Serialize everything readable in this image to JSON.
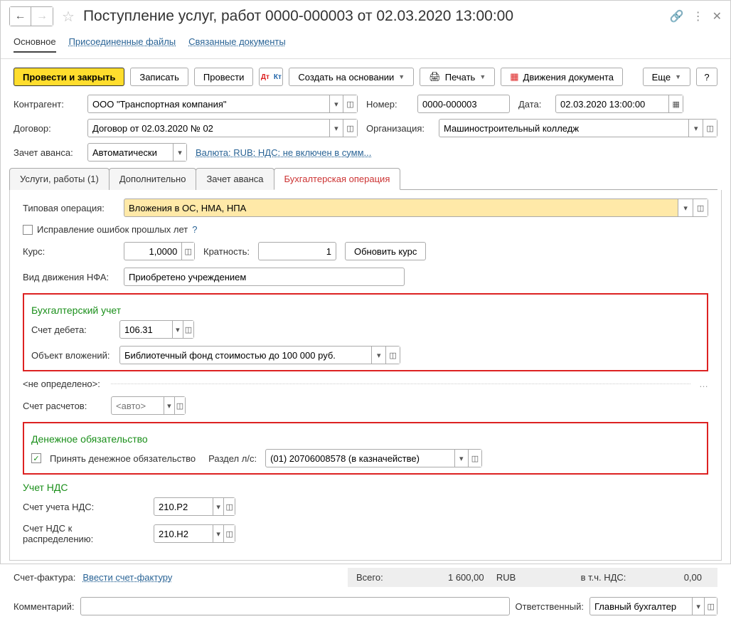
{
  "header": {
    "title": "Поступление услуг, работ 0000-000003 от 02.03.2020 13:00:00"
  },
  "nav": {
    "main": "Основное",
    "files": "Присоединенные файлы",
    "related": "Связанные документы"
  },
  "toolbar": {
    "post_close": "Провести и закрыть",
    "save": "Записать",
    "post": "Провести",
    "create_based": "Создать на основании",
    "print": "Печать",
    "movements": "Движения документа",
    "more": "Еще",
    "help": "?"
  },
  "fields": {
    "counterparty_lbl": "Контрагент:",
    "counterparty": "ООО \"Транспортная компания\"",
    "number_lbl": "Номер:",
    "number": "0000-000003",
    "date_lbl": "Дата:",
    "date": "02.03.2020 13:00:00",
    "contract_lbl": "Договор:",
    "contract": "Договор от 02.03.2020 № 02",
    "org_lbl": "Организация:",
    "org": "Машиностроительный колледж",
    "advance_lbl": "Зачет аванса:",
    "advance": "Автоматически",
    "currency_link": "Валюта: RUB; НДС: не включен в сумм..."
  },
  "inner_tabs": {
    "t1": "Услуги, работы (1)",
    "t2": "Дополнительно",
    "t3": "Зачет аванса",
    "t4": "Бухгалтерская операция"
  },
  "content": {
    "op_lbl": "Типовая операция:",
    "op": "Вложения в ОС, НМА, НПА",
    "fix_errors": "Исправление ошибок прошлых лет",
    "rate_lbl": "Курс:",
    "rate": "1,0000",
    "mult_lbl": "Кратность:",
    "mult": "1",
    "update_rate": "Обновить курс",
    "nfa_lbl": "Вид движения НФА:",
    "nfa": "Приобретено учреждением",
    "acc_title": "Бухгалтерский учет",
    "debit_lbl": "Счет дебета:",
    "debit": "106.31",
    "invest_lbl": "Объект вложений:",
    "invest": "Библиотечный фонд стоимостью до 100 000 руб.",
    "undef": "<не определено>:",
    "settle_lbl": "Счет расчетов:",
    "settle_ph": "<авто>",
    "money_title": "Денежное обязательство",
    "accept_money": "Принять денежное обязательство",
    "section_lbl": "Раздел л/с:",
    "section": "(01) 20706008578 (в казначействе)",
    "vat_title": "Учет НДС",
    "vat_acc_lbl": "Счет учета НДС:",
    "vat_acc": "210.Р2",
    "vat_dist_lbl": "Счет НДС к распределению:",
    "vat_dist": "210.Н2"
  },
  "footer": {
    "invoice_lbl": "Счет-фактура:",
    "invoice_link": "Ввести счет-фактуру",
    "total_lbl": "Всего:",
    "total": "1 600,00",
    "currency": "RUB",
    "vat_incl_lbl": "в т.ч. НДС:",
    "vat_incl": "0,00",
    "comment_lbl": "Комментарий:",
    "resp_lbl": "Ответственный:",
    "resp": "Главный бухгалтер"
  }
}
